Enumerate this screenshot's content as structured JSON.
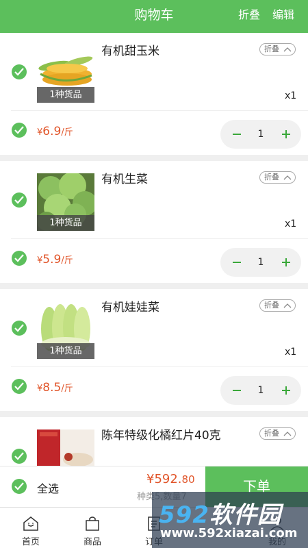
{
  "header": {
    "title": "购物车",
    "fold_label": "折叠",
    "edit_label": "编辑"
  },
  "colors": {
    "brand_green": "#5cbf5c",
    "price_orange": "#e1552a"
  },
  "items": [
    {
      "name": "有机甜玉米",
      "tag": "1种货品",
      "fold": "折叠",
      "qty_label": "x1",
      "price_symbol": "¥",
      "price_value": "6.9",
      "price_unit": "/斤",
      "quantity": "1"
    },
    {
      "name": "有机生菜",
      "tag": "1种货品",
      "fold": "折叠",
      "qty_label": "x1",
      "price_symbol": "¥",
      "price_value": "5.9",
      "price_unit": "/斤",
      "quantity": "1"
    },
    {
      "name": "有机娃娃菜",
      "tag": "1种货品",
      "fold": "折叠",
      "qty_label": "x1",
      "price_symbol": "¥",
      "price_value": "8.5",
      "price_unit": "/斤",
      "quantity": "1"
    },
    {
      "name": "陈年特级化橘红片40克",
      "fold": "折叠"
    }
  ],
  "footer": {
    "select_all": "全选",
    "total_int": "¥592.",
    "total_dec": "80",
    "summary": "种类5,数量7",
    "order_button": "下单"
  },
  "tabs": [
    {
      "label": "首页",
      "icon": "home-icon"
    },
    {
      "label": "商品",
      "icon": "bag-icon"
    },
    {
      "label": "订单",
      "icon": "list-icon"
    },
    {
      "label": "我的",
      "icon": "user-icon"
    }
  ],
  "watermark": {
    "brand_a": "592",
    "brand_b": "软件园",
    "url": "www.592xiazai.com"
  }
}
